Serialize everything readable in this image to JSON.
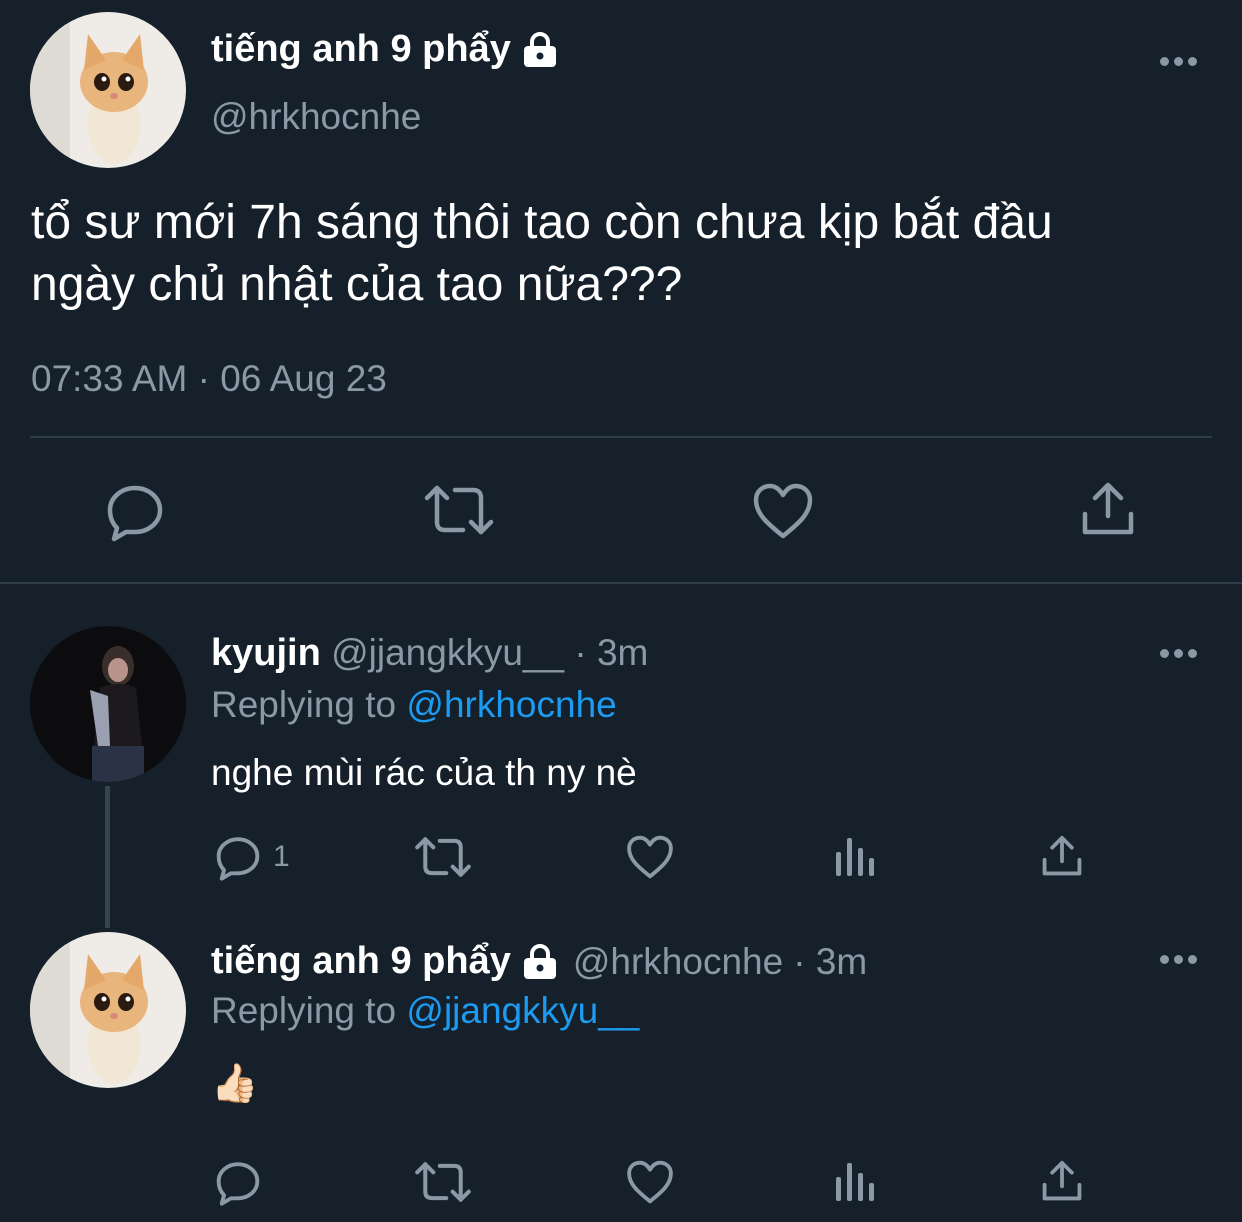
{
  "main_tweet": {
    "display_name": "tiếng anh 9 phẩy",
    "handle": "@hrkhocnhe",
    "text_line1": "tổ sư mới 7h sáng thôi tao còn chưa kịp bắt đầu",
    "text_line2": "ngày chủ nhật của tao nữa???",
    "timestamp": "07:33 AM · 06 Aug 23"
  },
  "replies": [
    {
      "display_name": "kyujin",
      "handle": "@jjangkkyu__",
      "time": "· 3m",
      "replying_prefix": "Replying to",
      "replying_to": "@hrkhocnhe",
      "text": "nghe mùi rác của th ny nè",
      "reply_count": "1"
    },
    {
      "display_name": "tiếng anh 9 phẩy",
      "handle": "@hrkhocnhe",
      "time": "· 3m",
      "replying_prefix": "Replying to",
      "replying_to": "@jjangkkyu__",
      "text": "👍🏻"
    }
  ],
  "icons": {
    "reply": "reply-icon",
    "retweet": "retweet-icon",
    "like": "heart-icon",
    "share": "share-icon",
    "analytics": "analytics-icon",
    "lock": "lock-icon",
    "more": "more-icon"
  },
  "colors": {
    "background": "#15202b",
    "text": "#ffffff",
    "muted": "#8b98a5",
    "link": "#1d9bf0"
  }
}
